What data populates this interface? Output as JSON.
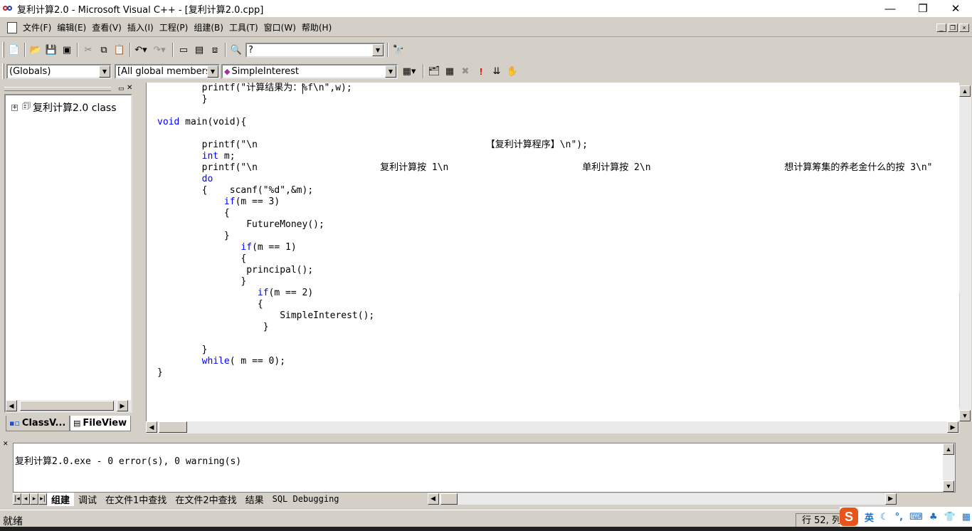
{
  "window": {
    "title": "复利计算2.0 - Microsoft Visual C++ - [复利计算2.0.cpp]",
    "minimize": "—",
    "restore": "❐",
    "close": "✕"
  },
  "menu": [
    "文件(F)",
    "编辑(E)",
    "查看(V)",
    "插入(I)",
    "工程(P)",
    "组建(B)",
    "工具(T)",
    "窗口(W)",
    "帮助(H)"
  ],
  "toolbar": {
    "find_combo": "?",
    "scope_combo": "(Globals)",
    "members_combo": "[All global members",
    "function_combo": "SimpleInterest"
  },
  "workspace": {
    "tree_root": "复利计算2.0 class",
    "tabs": [
      "ClassV...",
      "FileView"
    ]
  },
  "editor": {
    "lines": [
      {
        "indent": "        ",
        "kw": "",
        "text": "printf(\"计算结果为：%f\\n\",w);"
      },
      {
        "indent": "        ",
        "kw": "",
        "text": "}"
      },
      {
        "indent": "",
        "kw": "",
        "text": ""
      },
      {
        "indent": "",
        "kw": "void",
        "text": " main(void){"
      },
      {
        "indent": "",
        "kw": "",
        "text": ""
      },
      {
        "indent": "        ",
        "kw": "",
        "text": "printf(\"\\n                                         【复利计算程序】\\n\");"
      },
      {
        "indent": "        ",
        "kw": "int",
        "text": " m;"
      },
      {
        "indent": "        ",
        "kw": "",
        "text": "printf(\"\\n                      复利计算按 1\\n                        单利计算按 2\\n                        想计算筹集的养老金什么的按 3\\n\""
      },
      {
        "indent": "        ",
        "kw": "do",
        "text": ""
      },
      {
        "indent": "        ",
        "kw": "",
        "text": "{    scanf(\"%d\",&m);"
      },
      {
        "indent": "            ",
        "kw": "if",
        "text": "(m == 3)"
      },
      {
        "indent": "            ",
        "kw": "",
        "text": "{"
      },
      {
        "indent": "                ",
        "kw": "",
        "text": "FutureMoney();"
      },
      {
        "indent": "            ",
        "kw": "",
        "text": "}"
      },
      {
        "indent": "               ",
        "kw": "if",
        "text": "(m == 1)"
      },
      {
        "indent": "               ",
        "kw": "",
        "text": "{"
      },
      {
        "indent": "                ",
        "kw": "",
        "text": "principal();"
      },
      {
        "indent": "               ",
        "kw": "",
        "text": "}"
      },
      {
        "indent": "                  ",
        "kw": "if",
        "text": "(m == 2)"
      },
      {
        "indent": "                  ",
        "kw": "",
        "text": "{"
      },
      {
        "indent": "                      ",
        "kw": "",
        "text": "SimpleInterest();"
      },
      {
        "indent": "                  ",
        "kw": "",
        "text": " }"
      },
      {
        "indent": "",
        "kw": "",
        "text": ""
      },
      {
        "indent": "        ",
        "kw": "",
        "text": "}"
      },
      {
        "indent": "        ",
        "kw": "while",
        "text": "( m == 0);"
      },
      {
        "indent": "",
        "kw": "",
        "text": "}"
      }
    ]
  },
  "output": {
    "text": "复利计算2.0.exe - 0 error(s), 0 warning(s)",
    "tabs": [
      "组建",
      "调试",
      "在文件1中查找",
      "在文件2中查找",
      "结果",
      "SQL Debugging"
    ]
  },
  "status": {
    "text": "就绪",
    "position": "行 52, 列"
  },
  "ime": {
    "logo": "S",
    "mode": "英"
  },
  "colors": {
    "keyword": "#0000ff",
    "chrome": "#d4d0c8",
    "ime_brand": "#e8541c"
  }
}
